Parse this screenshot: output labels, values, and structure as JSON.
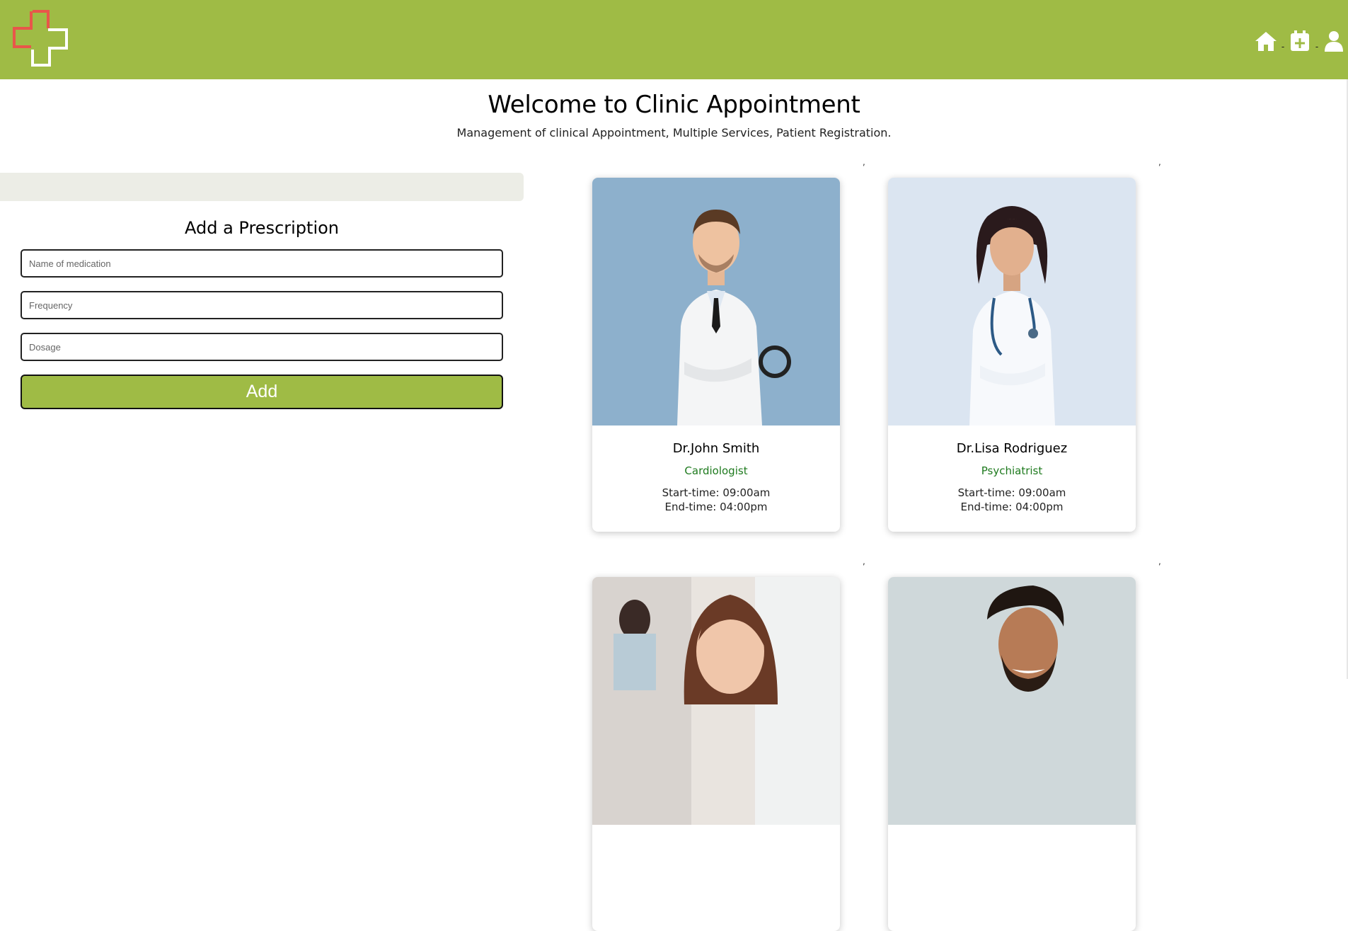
{
  "colors": {
    "brand": "#9fbb45",
    "specialty": "#1e7a1e",
    "banner": "#ecede6",
    "logo_red": "#e8564a"
  },
  "header": {
    "logo_icon": "medical-cross-logo-icon",
    "nav": [
      {
        "icon": "home-icon"
      },
      {
        "icon": "calendar-plus-icon"
      },
      {
        "icon": "user-icon"
      }
    ],
    "separator": "-"
  },
  "welcome": {
    "title": "Welcome to Clinic Appointment",
    "subtitle": "Management of clinical Appointment, Multiple Services, Patient Registration."
  },
  "prescription_form": {
    "title": "Add a Prescription",
    "fields": [
      {
        "placeholder": "Name of medication",
        "value": ""
      },
      {
        "placeholder": "Frequency",
        "value": ""
      },
      {
        "placeholder": "Dosage",
        "value": ""
      }
    ],
    "submit_label": "Add"
  },
  "separator_mark": ",",
  "doctors": [
    {
      "name": "Dr.John Smith",
      "specialty": "Cardiologist",
      "start": "Start-time: 09:00am",
      "end": "End-time: 04:00pm"
    },
    {
      "name": "Dr.Lisa Rodriguez",
      "specialty": "Psychiatrist",
      "start": "Start-time: 09:00am",
      "end": "End-time: 04:00pm"
    },
    {
      "name": "",
      "specialty": "",
      "start": "",
      "end": ""
    },
    {
      "name": "",
      "specialty": "",
      "start": "",
      "end": ""
    }
  ]
}
